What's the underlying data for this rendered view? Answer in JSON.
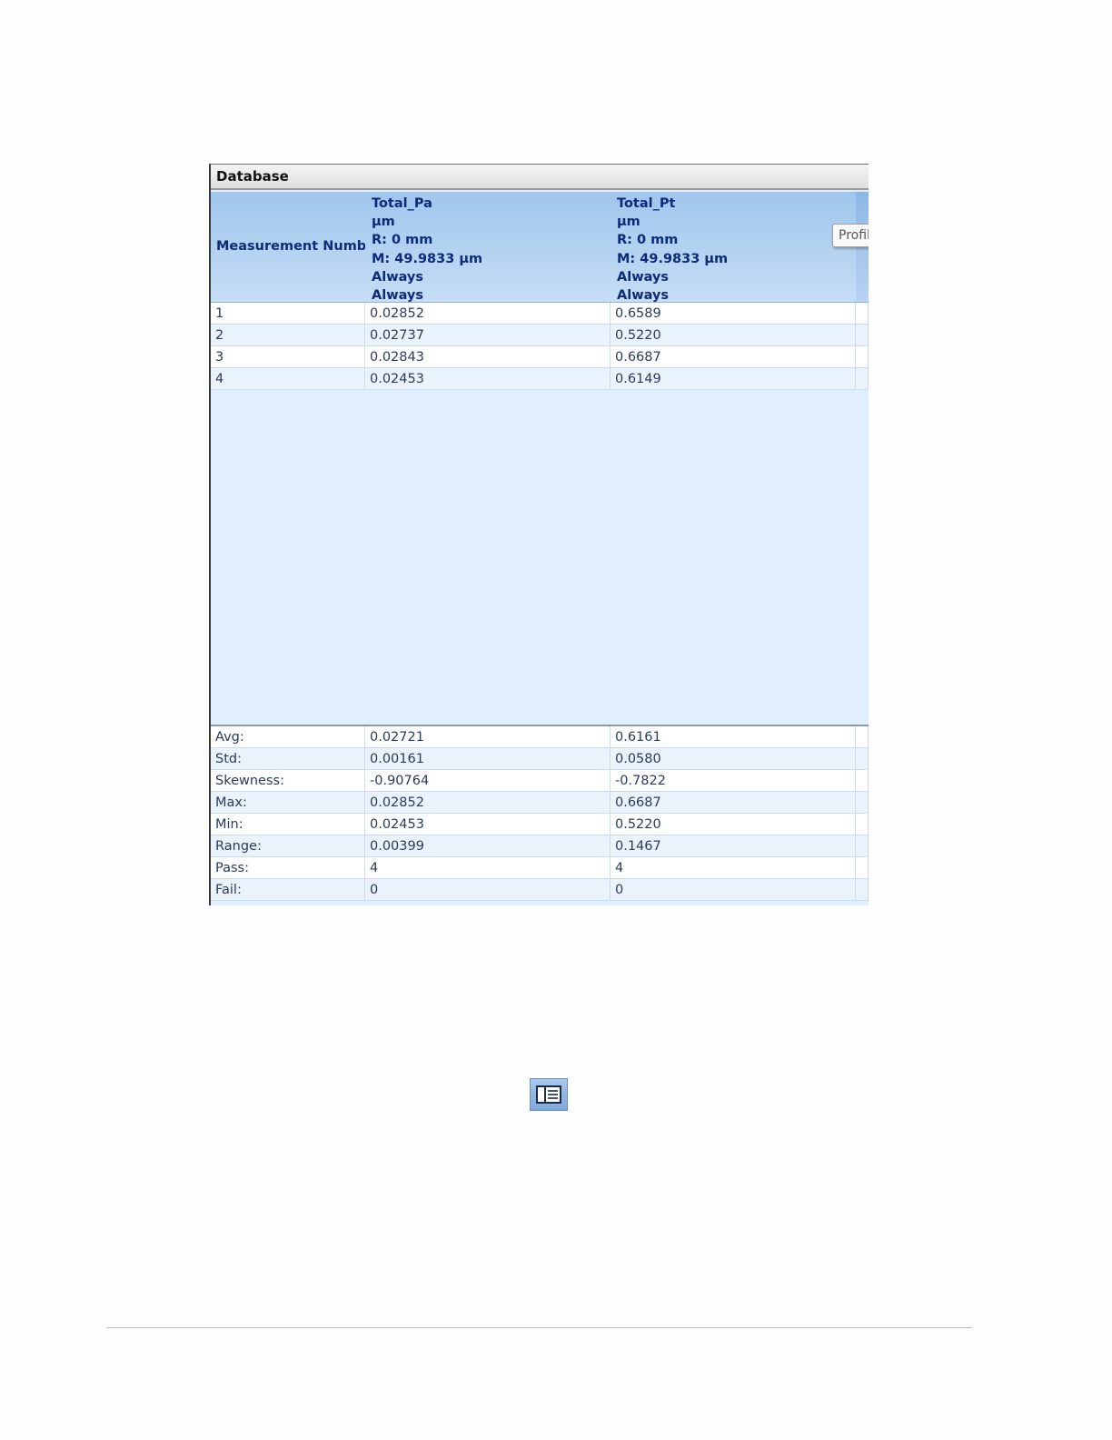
{
  "panel": {
    "title": "Database",
    "tab_chip_label": "Profil"
  },
  "columns": [
    {
      "header_lines": [
        "Measurement Number"
      ]
    },
    {
      "header_lines": [
        "Total_Pa",
        "µm",
        "R: 0 mm",
        "M: 49.9833 µm",
        "Always",
        "Always"
      ]
    },
    {
      "header_lines": [
        "Total_Pt",
        "µm",
        "R: 0 mm",
        "M: 49.9833 µm",
        "Always",
        "Always"
      ]
    }
  ],
  "measurements": [
    [
      "1",
      "0.02852",
      "0.6589"
    ],
    [
      "2",
      "0.02737",
      "0.5220"
    ],
    [
      "3",
      "0.02843",
      "0.6687"
    ],
    [
      "4",
      "0.02453",
      "0.6149"
    ]
  ],
  "statistics": [
    [
      "Avg:",
      "0.02721",
      "0.6161"
    ],
    [
      "Std:",
      "0.00161",
      "0.0580"
    ],
    [
      "Skewness:",
      "-0.90764",
      "-0.7822"
    ],
    [
      "Max:",
      "0.02852",
      "0.6687"
    ],
    [
      "Min:",
      "0.02453",
      "0.5220"
    ],
    [
      "Range:",
      "0.00399",
      "0.1467"
    ],
    [
      "Pass:",
      "4",
      "4"
    ],
    [
      "Fail:",
      "0",
      "0"
    ]
  ],
  "icons": {
    "toolbar_button": "list-view-icon"
  },
  "colors": {
    "header_text": "#0d2b7a",
    "cell_text": "#2b3b5a",
    "panel_background": "#e1eefb",
    "header_gradient_top": "#9fc6ed"
  }
}
